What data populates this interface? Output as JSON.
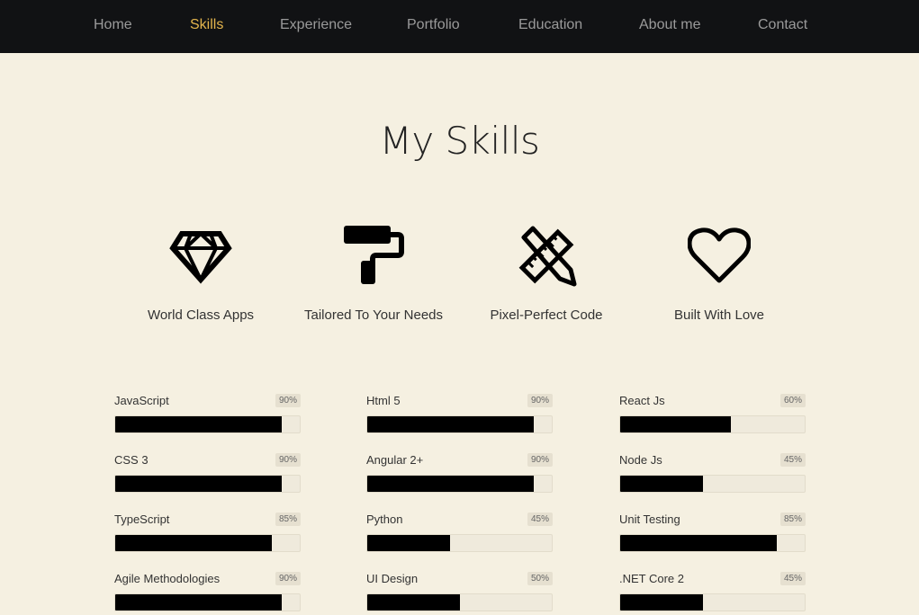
{
  "nav": {
    "items": [
      {
        "label": "Home",
        "active": false
      },
      {
        "label": "Skills",
        "active": true
      },
      {
        "label": "Experience",
        "active": false
      },
      {
        "label": "Portfolio",
        "active": false
      },
      {
        "label": "Education",
        "active": false
      },
      {
        "label": "About me",
        "active": false
      },
      {
        "label": "Contact",
        "active": false
      }
    ]
  },
  "section": {
    "title": "My Skills"
  },
  "features": [
    {
      "icon": "diamond-icon",
      "label": "World Class Apps"
    },
    {
      "icon": "paint-roller-icon",
      "label": "Tailored To Your Needs"
    },
    {
      "icon": "ruler-pencil-icon",
      "label": "Pixel-Perfect Code"
    },
    {
      "icon": "heart-icon",
      "label": "Built With Love"
    }
  ],
  "skills": [
    {
      "name": "JavaScript",
      "percent_label": "90%",
      "value": 90
    },
    {
      "name": "Html 5",
      "percent_label": "90%",
      "value": 90
    },
    {
      "name": "React Js",
      "percent_label": "60%",
      "value": 60
    },
    {
      "name": "CSS 3",
      "percent_label": "90%",
      "value": 90
    },
    {
      "name": "Angular 2+",
      "percent_label": "90%",
      "value": 90
    },
    {
      "name": "Node Js",
      "percent_label": "45%",
      "value": 45
    },
    {
      "name": "TypeScript",
      "percent_label": "85%",
      "value": 85
    },
    {
      "name": "Python",
      "percent_label": "45%",
      "value": 45
    },
    {
      "name": "Unit Testing",
      "percent_label": "85%",
      "value": 85
    },
    {
      "name": "Agile Methodologies",
      "percent_label": "90%",
      "value": 90
    },
    {
      "name": "UI Design",
      "percent_label": "50%",
      "value": 50
    },
    {
      "name": ".NET Core 2",
      "percent_label": "45%",
      "value": 45
    }
  ],
  "colors": {
    "nav_background": "#111214",
    "nav_text": "#9a9a9a",
    "nav_active": "#e4b54d",
    "page_background": "#f5f0e1",
    "bar_fill": "#000000",
    "bar_track": "#efeadc"
  }
}
